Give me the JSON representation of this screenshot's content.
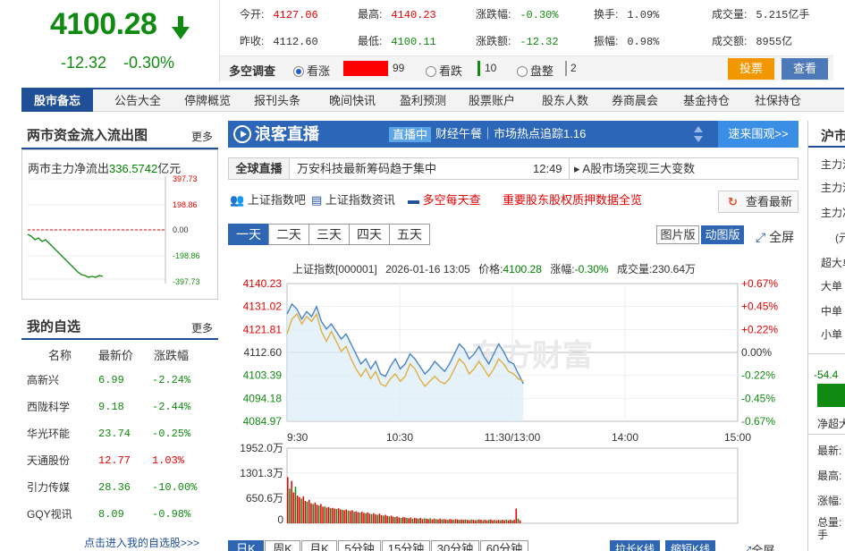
{
  "quote": {
    "price": "4100.28",
    "change": "-12.32",
    "change_pct": "-0.30%",
    "colors": {
      "down": "#118a11",
      "up": "#e60000"
    },
    "fields": [
      {
        "label": "今开:",
        "value": "4127.06",
        "tone": "up"
      },
      {
        "label": "最高:",
        "value": "4140.23",
        "tone": "up"
      },
      {
        "label": "涨跌幅:",
        "value": "-0.30%",
        "tone": "down"
      },
      {
        "label": "换手:",
        "value": "1.09%",
        "tone": "plain"
      },
      {
        "label": "成交量:",
        "value": "5.215亿手",
        "tone": "plain"
      },
      {
        "label": "昨收:",
        "value": "4112.60",
        "tone": "plain"
      },
      {
        "label": "最低:",
        "value": "4100.11",
        "tone": "down"
      },
      {
        "label": "涨跌额:",
        "value": "-12.32",
        "tone": "down"
      },
      {
        "label": "振幅:",
        "value": "0.98%",
        "tone": "plain"
      },
      {
        "label": "成交额:",
        "value": "8955亿",
        "tone": "plain"
      }
    ]
  },
  "poll": {
    "title": "多空调查",
    "bull_label": "看涨",
    "bull_count": "99",
    "bear_label": "看跌",
    "bear_count": "10",
    "flat_label": "盘整",
    "flat_count": "2",
    "vote_button": "投票",
    "view_button": "查看"
  },
  "nav": {
    "home": "股市备忘",
    "items": [
      "公告大全",
      "停牌概览",
      "报刊头条",
      "晚间快讯",
      "盈利预测",
      "股票账户",
      "股东人数",
      "券商晨会",
      "基金持仓",
      "社保持仓"
    ]
  },
  "flow_panel": {
    "title": "两市资金流入流出图",
    "more": "更多",
    "label": "两市主力净流出",
    "value": "336.5742",
    "unit": "亿元",
    "ticks": [
      "397.73",
      "198.86",
      "0.00",
      "-198.86",
      "-397.73"
    ]
  },
  "watchlist": {
    "title": "我的自选",
    "more": "更多",
    "headers": [
      "名称",
      "最新价",
      "涨跌幅"
    ],
    "rows": [
      {
        "name": "高新兴",
        "price": "6.99",
        "pct": "-2.24%",
        "tone": "down"
      },
      {
        "name": "西陇科学",
        "price": "9.18",
        "pct": "-2.44%",
        "tone": "down"
      },
      {
        "name": "华光环能",
        "price": "23.74",
        "pct": "-0.25%",
        "tone": "down"
      },
      {
        "name": "天通股份",
        "price": "12.77",
        "pct": "1.03%",
        "tone": "up"
      },
      {
        "name": "引力传媒",
        "price": "28.36",
        "pct": "-10.00%",
        "tone": "down"
      },
      {
        "name": "GQY视讯",
        "price": "8.09",
        "pct": "-0.98%",
        "tone": "down"
      }
    ],
    "footer": "点击进入我的自选股>>>"
  },
  "live": {
    "logo": "浪客直播",
    "status": "直播中",
    "text": "财经午餐｜市场热点追踪1.16",
    "watch_button": "速来围观>>"
  },
  "news": {
    "tag": "全球直播",
    "headline": "万安科技最新筹码趋于集中",
    "time": "12:49",
    "side_headline": "A股市场突现三大变数"
  },
  "links": {
    "items": [
      "上证指数吧",
      "上证指数资讯",
      "多空每天查"
    ],
    "highlight": "重要股东股权质押数据全览",
    "refresh_button": "查看最新"
  },
  "period_tabs": [
    "一天",
    "二天",
    "三天",
    "四天",
    "五天"
  ],
  "view_toggle": {
    "static": "图片版",
    "dynamic": "动图版",
    "fullscreen": "全屏"
  },
  "chart_data": {
    "type": "line",
    "info": {
      "name": "上证指数[000001]",
      "datetime": "2026-01-16 13:05",
      "price_label": "价格:",
      "price": "4100.28",
      "pct_label": "涨幅:",
      "pct": "-0.30%",
      "vol_label": "成交量:",
      "volume": "230.64万"
    },
    "watermark": "东方财富",
    "y_left": [
      "4140.23",
      "4131.02",
      "4121.81",
      "4112.60",
      "4103.39",
      "4094.18",
      "4084.97"
    ],
    "y_right": [
      "+0.67%",
      "+0.45%",
      "+0.22%",
      "0.00%",
      "-0.22%",
      "-0.45%",
      "-0.67%"
    ],
    "x_ticks": [
      "9:30",
      "10:30",
      "11:30/13:00",
      "14:00",
      "15:00"
    ],
    "ylim": [
      4084.97,
      4140.23
    ],
    "prev_close": 4112.6,
    "series": [
      {
        "values": [
          4128,
          4132,
          4130,
          4126,
          4129,
          4127,
          4131,
          4125,
          4122,
          4124,
          4121,
          4118,
          4120,
          4116,
          4112,
          4108,
          4110,
          4106,
          4109,
          4104,
          4103,
          4107,
          4110,
          4106,
          4108,
          4112,
          4110,
          4107,
          4104,
          4106,
          4109,
          4107,
          4105,
          4108,
          4112,
          4116,
          4114,
          4110,
          4112,
          4115,
          4111,
          4108,
          4112,
          4116,
          4113,
          4109,
          4108,
          4104,
          4100
        ]
      },
      {
        "values": [
          4120,
          4126,
          4128,
          4124,
          4127,
          4125,
          4128,
          4121,
          4117,
          4121,
          4117,
          4113,
          4115,
          4110,
          4106,
          4103,
          4106,
          4102,
          4105,
          4100,
          4099,
          4102,
          4104,
          4101,
          4103,
          4108,
          4106,
          4102,
          4099,
          4101,
          4103,
          4101,
          4100,
          4102,
          4106,
          4110,
          4108,
          4104,
          4106,
          4109,
          4106,
          4103,
          4106,
          4110,
          4108,
          4105,
          4104,
          4102,
          4101
        ]
      }
    ],
    "volume": {
      "ticks": [
        "1952.0万",
        "1301.3万",
        "650.6万",
        "0"
      ],
      "ylim": [
        0,
        1952.0
      ],
      "values": [
        1200,
        900,
        1100,
        800,
        950,
        720,
        680,
        640,
        700,
        580,
        560,
        610,
        520,
        500,
        540,
        480,
        460,
        500,
        430,
        440,
        410,
        420,
        390,
        400,
        380,
        370,
        390,
        360,
        350,
        340,
        360,
        330,
        320,
        340,
        300,
        310,
        290,
        280,
        300,
        270,
        260,
        280,
        250,
        240,
        260,
        230,
        220,
        250,
        210,
        200,
        220,
        190,
        180,
        200,
        170,
        160,
        180,
        150,
        140,
        160,
        150,
        140,
        130,
        150,
        120,
        140,
        130,
        120,
        140,
        110,
        130,
        120,
        110,
        130,
        100,
        120,
        110,
        100,
        120,
        100,
        110,
        100,
        90,
        110,
        100,
        90,
        110,
        100,
        90,
        100,
        90,
        100,
        90,
        80,
        100,
        90,
        80,
        90,
        100,
        90,
        80,
        90,
        80,
        90,
        100,
        80,
        90,
        80,
        90,
        80,
        90,
        80,
        100,
        80,
        90,
        80,
        90,
        380,
        120,
        80
      ]
    }
  },
  "kline_tabs": [
    "日K",
    "周K",
    "月K",
    "5分钟",
    "15分钟",
    "30分钟",
    "60分钟"
  ],
  "kline_buttons": [
    "拉长K线",
    "缩短K线",
    "全屏"
  ],
  "right_panel": {
    "title": "沪市",
    "items": [
      "主力流",
      "主力流",
      "主力净"
    ],
    "sub": "(元",
    "labels": [
      "超大单",
      "大单",
      "中单",
      "小单"
    ],
    "value": "-54.4",
    "net_label": "净超大",
    "fields": [
      "最新:",
      "最高:",
      "涨幅:",
      "总量:",
      "手"
    ]
  }
}
